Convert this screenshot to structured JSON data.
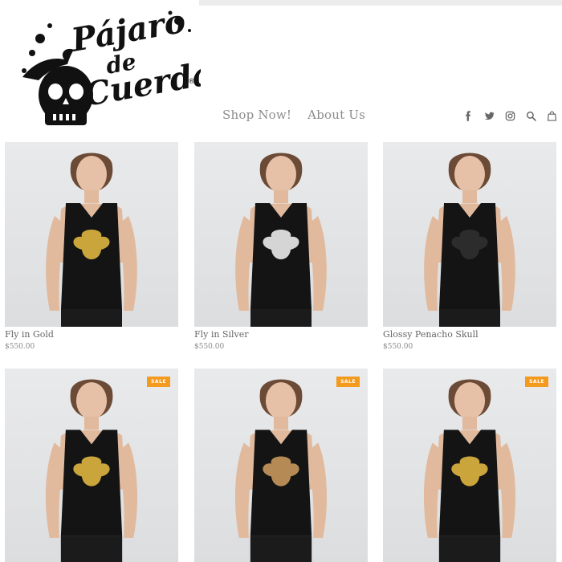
{
  "brand": {
    "logo_line1": "Pájaro",
    "logo_line2": "de",
    "logo_line3": "Cuerda",
    "logo_mark": "®"
  },
  "nav": {
    "items": [
      {
        "label": "Shop Now!"
      },
      {
        "label": "About Us"
      }
    ]
  },
  "header_icons": [
    "facebook-icon",
    "twitter-icon",
    "instagram-icon",
    "search-icon",
    "cart-icon"
  ],
  "products": [
    {
      "name": "Fly in Gold",
      "price": "$550.00",
      "sale": "",
      "shirt": "#141414",
      "print": "#c9a53c"
    },
    {
      "name": "Fly in Silver",
      "price": "$550.00",
      "sale": "",
      "shirt": "#141414",
      "print": "#d5d5d5"
    },
    {
      "name": "Glossy Penacho Skull",
      "price": "$550.00",
      "sale": "",
      "shirt": "#141414",
      "print": "#2c2c2c"
    },
    {
      "name": "",
      "price": "",
      "sale": "SALE",
      "shirt": "#141414",
      "print": "#c9a53c"
    },
    {
      "name": "",
      "price": "",
      "sale": "SALE",
      "shirt": "#141414",
      "print": "#b58a55"
    },
    {
      "name": "",
      "price": "",
      "sale": "SALE",
      "shirt": "#141414",
      "print": "#c9a53c"
    }
  ],
  "colors": {
    "accent_badge": "#f39a1f",
    "nav_text": "#8c8c8c",
    "photo_bg": "#e4e5e6"
  }
}
